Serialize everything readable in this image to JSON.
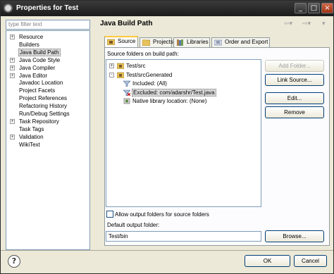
{
  "window": {
    "title": "Properties for Test"
  },
  "filter": {
    "placeholder": "type filter text"
  },
  "nav_tree": [
    {
      "label": "Resource",
      "expandable": true
    },
    {
      "label": "Builders",
      "expandable": false
    },
    {
      "label": "Java Build Path",
      "expandable": false,
      "selected": true
    },
    {
      "label": "Java Code Style",
      "expandable": true
    },
    {
      "label": "Java Compiler",
      "expandable": true
    },
    {
      "label": "Java Editor",
      "expandable": true
    },
    {
      "label": "Javadoc Location",
      "expandable": false
    },
    {
      "label": "Project Facets",
      "expandable": false
    },
    {
      "label": "Project References",
      "expandable": false
    },
    {
      "label": "Refactoring History",
      "expandable": false
    },
    {
      "label": "Run/Debug Settings",
      "expandable": false
    },
    {
      "label": "Task Repository",
      "expandable": true
    },
    {
      "label": "Task Tags",
      "expandable": false
    },
    {
      "label": "Validation",
      "expandable": true
    },
    {
      "label": "WikiText",
      "expandable": false
    }
  ],
  "page": {
    "title": "Java Build Path"
  },
  "tabs": [
    {
      "label": "Source",
      "active": true
    },
    {
      "label": "Projects"
    },
    {
      "label": "Libraries"
    },
    {
      "label": "Order and Export"
    }
  ],
  "source": {
    "list_label": "Source folders on build path:",
    "items": [
      {
        "label": "Test/src",
        "level": 0,
        "expander": "+",
        "icon": "package-folder-icon"
      },
      {
        "label": "Test/srcGenerated",
        "level": 0,
        "expander": "-",
        "icon": "package-folder-icon"
      },
      {
        "label": "Included: (All)",
        "level": 1,
        "icon": "included-filter-icon"
      },
      {
        "label": "Excluded: com/adarshr/Test.java",
        "level": 1,
        "icon": "excluded-filter-icon",
        "selected": true
      },
      {
        "label": "Native library location: (None)",
        "level": 1,
        "icon": "native-library-icon"
      }
    ]
  },
  "buttons": {
    "add_folder": "Add Folder...",
    "link_source": "Link Source...",
    "edit": "Edit...",
    "remove": "Remove",
    "browse": "Browse...",
    "ok": "OK",
    "cancel": "Cancel"
  },
  "allow_output": {
    "label": "Allow output folders for source folders",
    "checked": false
  },
  "output": {
    "label": "Default output folder:",
    "value": "Test/bin"
  },
  "icons": {
    "nav_back": "back-arrow-icon",
    "nav_forward": "forward-arrow-icon",
    "help": "help-icon"
  }
}
